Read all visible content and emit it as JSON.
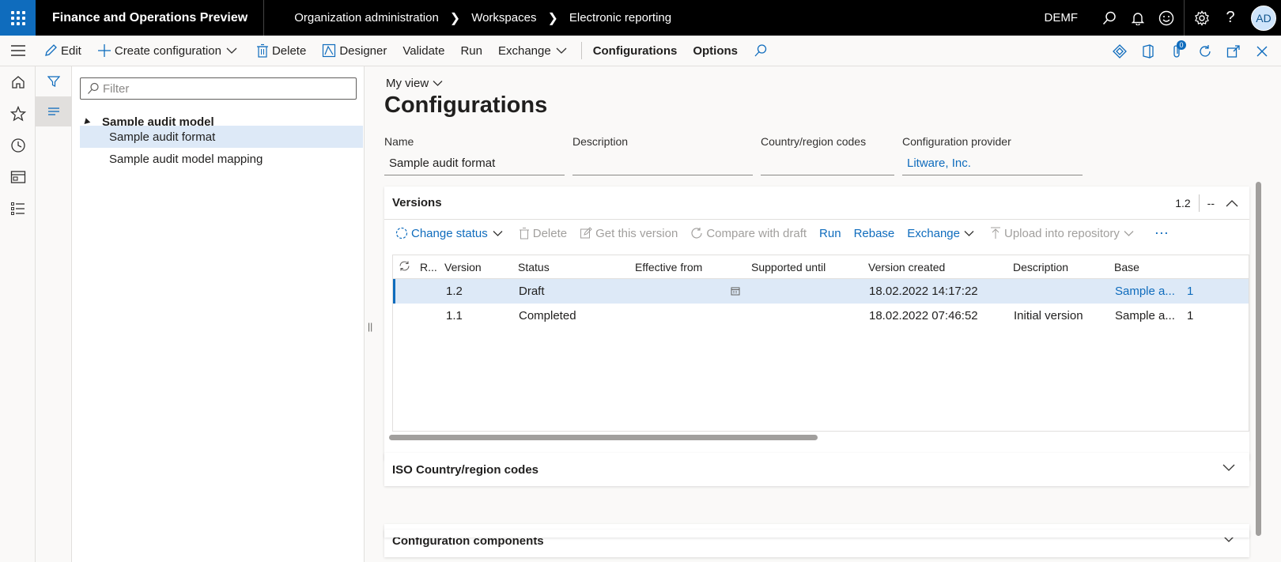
{
  "topbar": {
    "app_title": "Finance and Operations Preview",
    "breadcrumbs": [
      "Organization administration",
      "Workspaces",
      "Electronic reporting"
    ],
    "company": "DEMF",
    "avatar_initials": "AD"
  },
  "actionpane": {
    "edit": "Edit",
    "create_configuration": "Create configuration",
    "delete": "Delete",
    "designer": "Designer",
    "validate": "Validate",
    "run": "Run",
    "exchange": "Exchange",
    "configurations_tab": "Configurations",
    "options_tab": "Options",
    "attachments_count": "0"
  },
  "tree": {
    "filter_placeholder": "Filter",
    "root": "Sample audit model",
    "items": [
      "Sample audit format",
      "Sample audit model mapping"
    ],
    "selected_index": 0
  },
  "main": {
    "my_view": "My view",
    "page_title": "Configurations",
    "fields": {
      "name_label": "Name",
      "name_value": "Sample audit format",
      "description_label": "Description",
      "description_value": "",
      "country_label": "Country/region codes",
      "country_value": "",
      "provider_label": "Configuration provider",
      "provider_value": "Litware, Inc."
    }
  },
  "versions": {
    "title": "Versions",
    "summary_version": "1.2",
    "summary_extra": "--",
    "toolbar": {
      "change_status": "Change status",
      "delete": "Delete",
      "get_this_version": "Get this version",
      "compare_with_draft": "Compare with draft",
      "run": "Run",
      "rebase": "Rebase",
      "exchange": "Exchange",
      "upload": "Upload into repository",
      "more": "⋯"
    },
    "columns": [
      "R...",
      "Version",
      "Status",
      "Effective from",
      "Supported until",
      "Version created",
      "Description",
      "Base",
      ""
    ],
    "rows": [
      {
        "version": "1.2",
        "status": "Draft",
        "effective_from": "",
        "supported_until": "",
        "created": "18.02.2022 14:17:22",
        "description": "",
        "base": "Sample a...",
        "base_version": "1"
      },
      {
        "version": "1.1",
        "status": "Completed",
        "effective_from": "",
        "supported_until": "",
        "created": "18.02.2022 07:46:52",
        "description": "Initial version",
        "base": "Sample a...",
        "base_version": "1"
      }
    ]
  },
  "fasttabs": {
    "iso": "ISO Country/region codes",
    "components": "Configuration components"
  },
  "colors": {
    "accent": "#0f6cbd",
    "selected_row": "#dde9f7",
    "topbar": "#000000"
  }
}
